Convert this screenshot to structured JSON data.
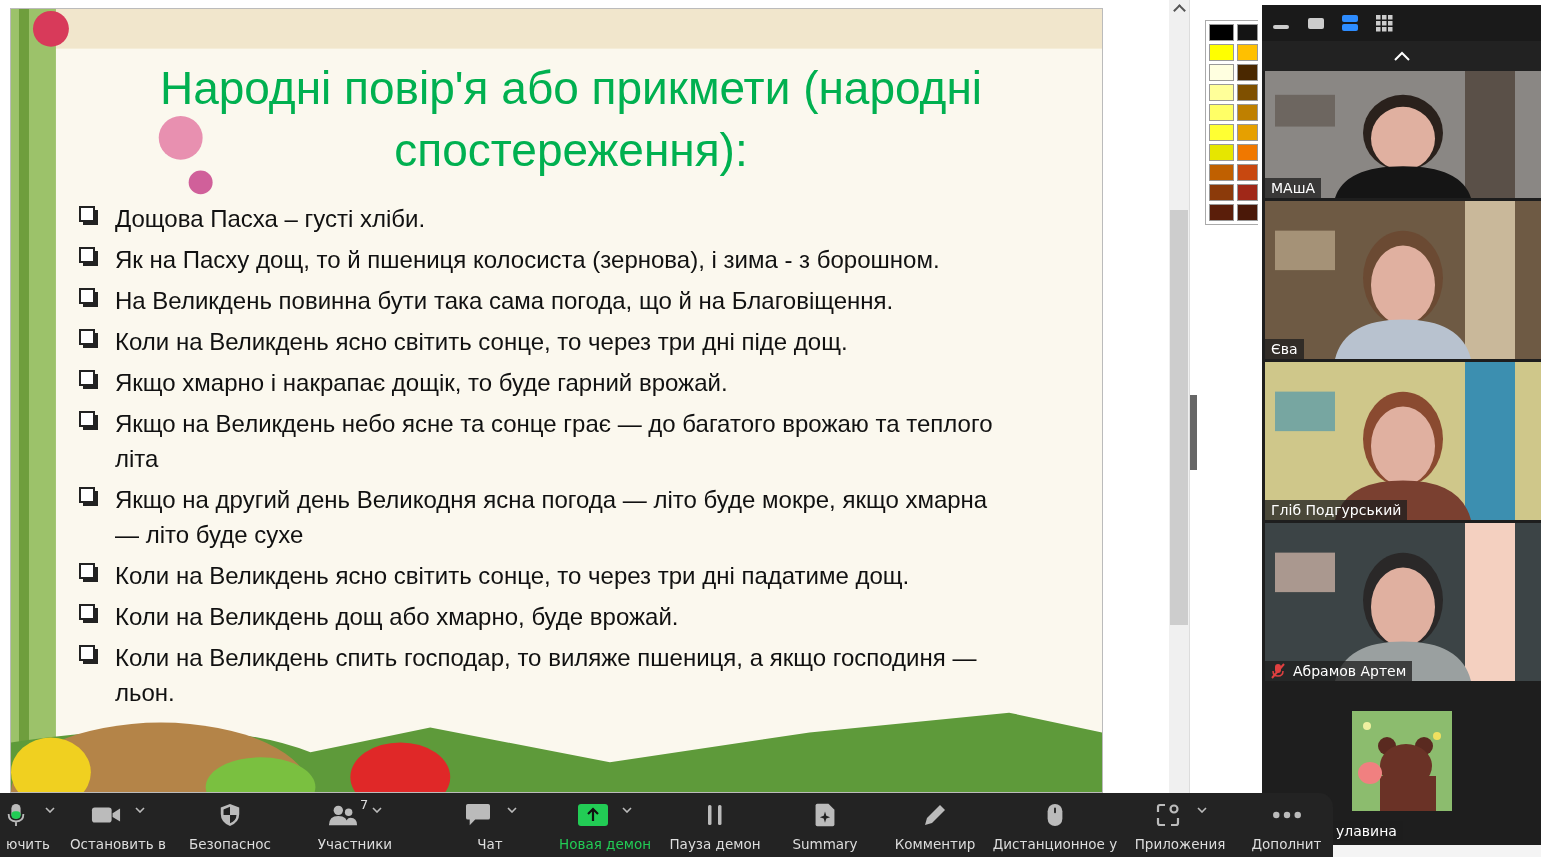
{
  "slide": {
    "title": "Народні повір'я або прикмети (народні спостереження):",
    "bullets": [
      "Дощова Пасха – густі хліби.",
      "Як на Пасху дощ, то й пшениця колосиста (зернова), і зима - з борошном.",
      "На Великдень повинна бути така сама погода, що й на Благовіщення.",
      "Коли на Великдень ясно світить сонце, то через три дні піде дощ.",
      "Якщо хмарно і накрапає дощік, то буде гарний врожай.",
      "Якщо на Великдень небо ясне та сонце грає — до багатого врожаю та теплого літа",
      "Якщо на другий день Великодня ясна погода — літо буде мокре, якщо хмарна — літо буде сухе",
      "Коли на Великдень ясно світить сонце, то через три дні падатиме дощ.",
      "Коли на Великдень дощ або хмарно, буде врожай.",
      "Коли на Великдень спить господар, то виляже пшениця, а якщо господиня — льон."
    ]
  },
  "palette": [
    {
      "color": "#000000"
    },
    {
      "color": "#141414"
    },
    {
      "color": "#ffff00"
    },
    {
      "color": "#ffc000"
    },
    {
      "color": "#ffffe0"
    },
    {
      "color": "#4a2800"
    },
    {
      "color": "#ffff99"
    },
    {
      "color": "#7f5000"
    },
    {
      "color": "#ffff66"
    },
    {
      "color": "#bf8000"
    },
    {
      "color": "#ffff33"
    },
    {
      "color": "#e6a000"
    },
    {
      "color": "#e6e600"
    },
    {
      "color": "#f07800"
    },
    {
      "color": "#c06000"
    },
    {
      "color": "#c84810"
    },
    {
      "color": "#8b3a0a"
    },
    {
      "color": "#a02818"
    },
    {
      "color": "#5a1e0a"
    },
    {
      "color": "#4a1808"
    }
  ],
  "view_modes": [
    {
      "kind": "minimize",
      "selected": false
    },
    {
      "kind": "single",
      "selected": false
    },
    {
      "kind": "speaker",
      "selected": true
    },
    {
      "kind": "gallery",
      "selected": false
    }
  ],
  "participants": [
    {
      "name": "МАшА",
      "muted": false,
      "kind": "video"
    },
    {
      "name": "Єва",
      "muted": false,
      "kind": "video"
    },
    {
      "name": "Гліб Подгурський",
      "muted": false,
      "kind": "video"
    },
    {
      "name": "Абрамов Артем",
      "muted": true,
      "kind": "video"
    },
    {
      "name": "улавина",
      "muted": false,
      "kind": "avatar"
    }
  ],
  "toolbar": [
    {
      "kind": "mic",
      "label": "ючить",
      "caret": true,
      "highlighted": false
    },
    {
      "kind": "camera",
      "label": "Остановить в",
      "caret": true,
      "highlighted": false
    },
    {
      "kind": "shield",
      "label": "Безопаснос",
      "caret": false,
      "highlighted": false
    },
    {
      "kind": "people",
      "label": "Участники",
      "count": "7",
      "caret": true,
      "highlighted": false
    },
    {
      "kind": "chat",
      "label": "Чат",
      "caret": true,
      "highlighted": false
    },
    {
      "kind": "share",
      "label": "Новая демон",
      "caret": true,
      "highlighted": true
    },
    {
      "kind": "pause",
      "label": "Пауза демон",
      "caret": false,
      "highlighted": false
    },
    {
      "kind": "summary",
      "label": "Summary",
      "caret": false,
      "highlighted": false
    },
    {
      "kind": "pencil",
      "label": "Комментир",
      "caret": false,
      "highlighted": false
    },
    {
      "kind": "mouse",
      "label": "Дистанционное у",
      "caret": false,
      "highlighted": false
    },
    {
      "kind": "apps",
      "label": "Приложения",
      "caret": true,
      "highlighted": false
    },
    {
      "kind": "more",
      "label": "Дополнит",
      "caret": false,
      "highlighted": false
    }
  ]
}
